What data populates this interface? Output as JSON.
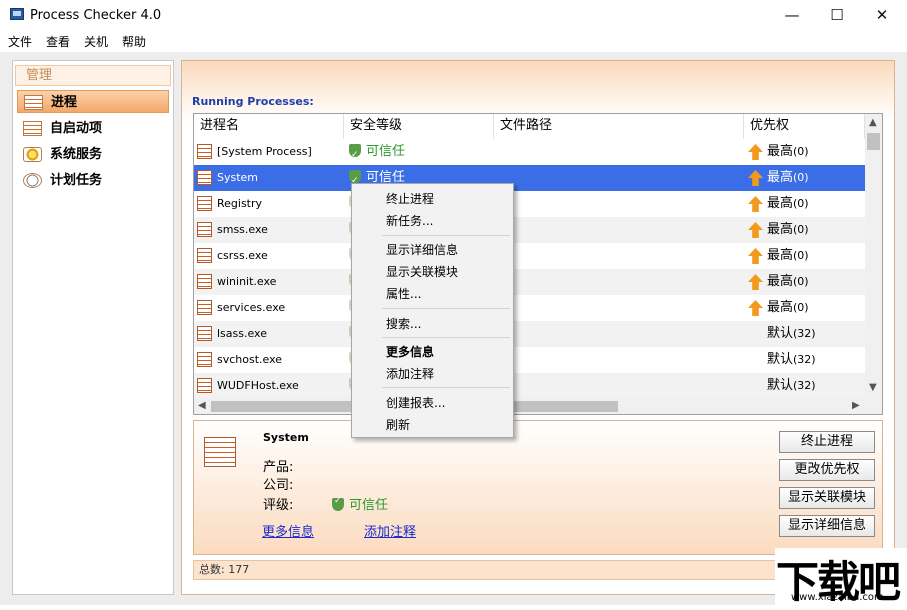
{
  "window": {
    "title": "Process Checker 4.0",
    "minimize": "—",
    "maximize": "☐",
    "close": "✕"
  },
  "menu": [
    "文件",
    "查看",
    "关机",
    "帮助"
  ],
  "sidebar": {
    "header": "管理",
    "items": [
      {
        "label": "进程",
        "icon": "process-list-icon",
        "active": true
      },
      {
        "label": "自启动项",
        "icon": "startup-icon",
        "active": false
      },
      {
        "label": "系统服务",
        "icon": "service-gear-icon",
        "active": false
      },
      {
        "label": "计划任务",
        "icon": "clock-icon",
        "active": false
      }
    ]
  },
  "process_list": {
    "heading": "Running Processes:",
    "columns": [
      "进程名",
      "安全等级",
      "文件路径",
      "优先权"
    ],
    "rows": [
      {
        "name": "[System Process]",
        "security": "可信任",
        "priority_main": "最高",
        "priority_sub": "(0)",
        "high": true
      },
      {
        "name": "System",
        "security": "可信任",
        "priority_main": "最高",
        "priority_sub": "(0)",
        "high": true
      },
      {
        "name": "Registry",
        "security": "",
        "priority_main": "最高",
        "priority_sub": "(0)",
        "high": true
      },
      {
        "name": "smss.exe",
        "security": "",
        "priority_main": "最高",
        "priority_sub": "(0)",
        "high": true
      },
      {
        "name": "csrss.exe",
        "security": "",
        "priority_main": "最高",
        "priority_sub": "(0)",
        "high": true
      },
      {
        "name": "wininit.exe",
        "security": "",
        "priority_main": "最高",
        "priority_sub": "(0)",
        "high": true
      },
      {
        "name": "services.exe",
        "security": "",
        "priority_main": "最高",
        "priority_sub": "(0)",
        "high": true
      },
      {
        "name": "lsass.exe",
        "security": "",
        "priority_main": "默认",
        "priority_sub": "(32)",
        "high": false
      },
      {
        "name": "svchost.exe",
        "security": "",
        "priority_main": "默认",
        "priority_sub": "(32)",
        "high": false
      },
      {
        "name": "WUDFHost.exe",
        "security": "",
        "priority_main": "默认",
        "priority_sub": "(32)",
        "high": false
      }
    ]
  },
  "context_menu": {
    "groups": [
      [
        "终止进程",
        "新任务..."
      ],
      [
        "显示详细信息",
        "显示关联模块",
        "属性..."
      ],
      [
        "搜索..."
      ],
      [
        "更多信息",
        "添加注释"
      ],
      [
        "创建报表...",
        "刷新"
      ]
    ]
  },
  "details": {
    "name": "System",
    "product_label": "产品:",
    "company_label": "公司:",
    "rating_label": "评级:",
    "rating_value": "可信任",
    "more_info": "更多信息",
    "add_note": "添加注释"
  },
  "actions": [
    "终止进程",
    "更改优先权",
    "显示关联模块",
    "显示详细信息"
  ],
  "status": {
    "total": "总数: 177"
  },
  "watermark": {
    "brand": "下载吧",
    "url": "www.xiazaiba.com"
  }
}
